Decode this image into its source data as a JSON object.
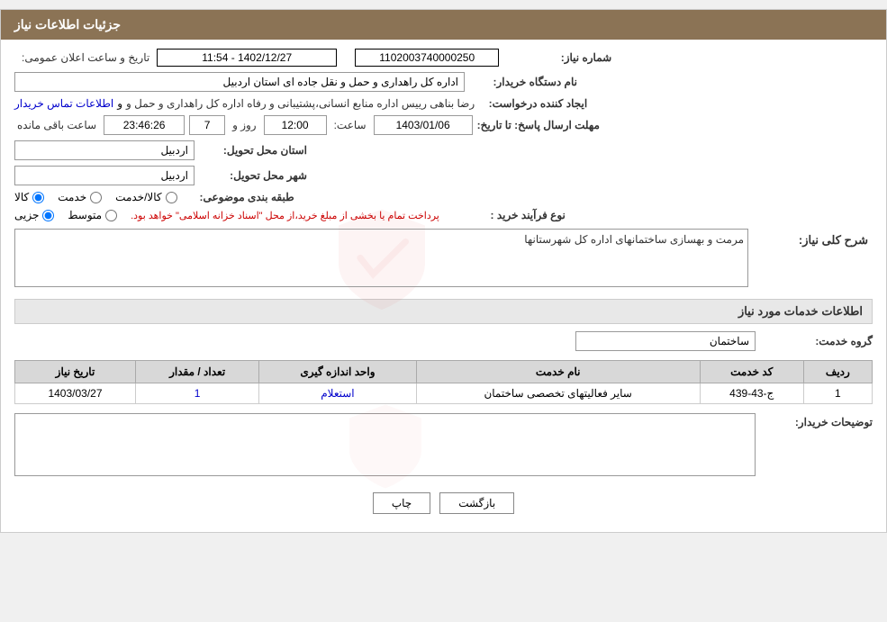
{
  "page": {
    "title": "جزئیات اطلاعات نیاز",
    "header": {
      "bg_color": "#8B7355"
    }
  },
  "fields": {
    "request_number_label": "شماره نیاز:",
    "request_number_value": "1102003740000250",
    "buyer_name_label": "نام دستگاه خریدار:",
    "buyer_name_value": "اداره کل راهداری و حمل و نقل جاده ای استان اردبیل",
    "creator_label": "ایجاد کننده درخواست:",
    "creator_value": "رضا بناهی رییس اداره منابع انسانی،پشتیبانی و رفاه اداره کل راهداری و حمل و",
    "creator_link": "اطلاعات تماس خریدار",
    "response_deadline_label": "مهلت ارسال پاسخ: تا تاریخ:",
    "date_value": "1403/01/06",
    "time_label": "ساعت:",
    "time_value": "12:00",
    "days_label": "روز و",
    "days_value": "7",
    "remaining_label": "ساعت باقی مانده",
    "remaining_value": "23:46:26",
    "province_label": "استان محل تحویل:",
    "province_value": "اردبیل",
    "city_label": "شهر محل تحویل:",
    "city_value": "اردبیل",
    "category_label": "طبقه بندی موضوعی:",
    "category_option1": "کالا",
    "category_option2": "خدمت",
    "category_option3": "کالا/خدمت",
    "process_label": "نوع فرآیند خرید :",
    "process_option1": "جزیی",
    "process_option2": "متوسط",
    "process_note": "پرداخت تمام یا بخشی از مبلغ خرید،از محل \"اسناد خزانه اسلامی\" خواهد بود.",
    "description_label": "شرح کلی نیاز:",
    "description_value": "مرمت و بهسازی ساختمانهای اداره کل شهرستانها",
    "services_section_title": "اطلاعات خدمات مورد نیاز",
    "service_group_label": "گروه خدمت:",
    "service_group_value": "ساختمان",
    "table": {
      "headers": [
        "ردیف",
        "کد خدمت",
        "نام خدمت",
        "واحد اندازه گیری",
        "تعداد / مقدار",
        "تاریخ نیاز"
      ],
      "rows": [
        {
          "row_num": "1",
          "service_code": "ج-43-439",
          "service_name": "سایر فعالیتهای تخصصی ساختمان",
          "unit": "استعلام",
          "quantity": "1",
          "date": "1403/03/27"
        }
      ]
    },
    "buyer_notes_label": "توضیحات خریدار:",
    "buyer_notes_value": "",
    "btn_back": "بازگشت",
    "btn_print": "چاپ",
    "announcement_date_label": "تاریخ و ساعت اعلان عمومی:"
  }
}
